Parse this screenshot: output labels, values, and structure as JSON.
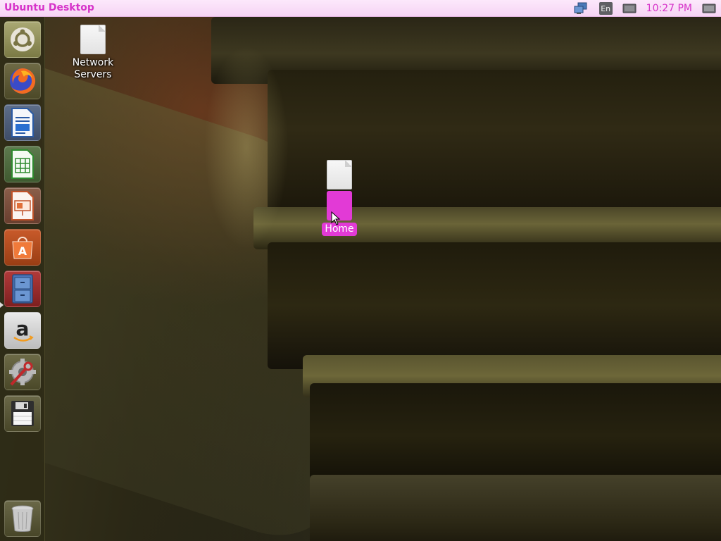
{
  "panel": {
    "title": "Ubuntu Desktop",
    "clock": "10:27 PM",
    "keyboard_layout": "En",
    "accent_color": "#d633c9",
    "indicators": [
      "network-icon",
      "keyboard-layout-indicator",
      "display-icon",
      "session-icon"
    ]
  },
  "launcher": {
    "items": [
      {
        "name": "ubuntu-dash-icon"
      },
      {
        "name": "firefox-icon"
      },
      {
        "name": "libreoffice-writer-icon"
      },
      {
        "name": "libreoffice-calc-icon"
      },
      {
        "name": "libreoffice-impress-icon"
      },
      {
        "name": "ubuntu-software-icon"
      },
      {
        "name": "file-manager-icon",
        "running": true
      },
      {
        "name": "amazon-icon"
      },
      {
        "name": "system-settings-icon"
      },
      {
        "name": "floppy-disk-icon"
      },
      {
        "name": "trash-icon"
      }
    ]
  },
  "desktop": {
    "icons": [
      {
        "label": "Network\nServers",
        "type": "file"
      },
      {
        "label": "",
        "type": "file"
      },
      {
        "label": "Home",
        "type": "folder",
        "selected": true
      }
    ],
    "selection_color": "#e23ad6"
  }
}
